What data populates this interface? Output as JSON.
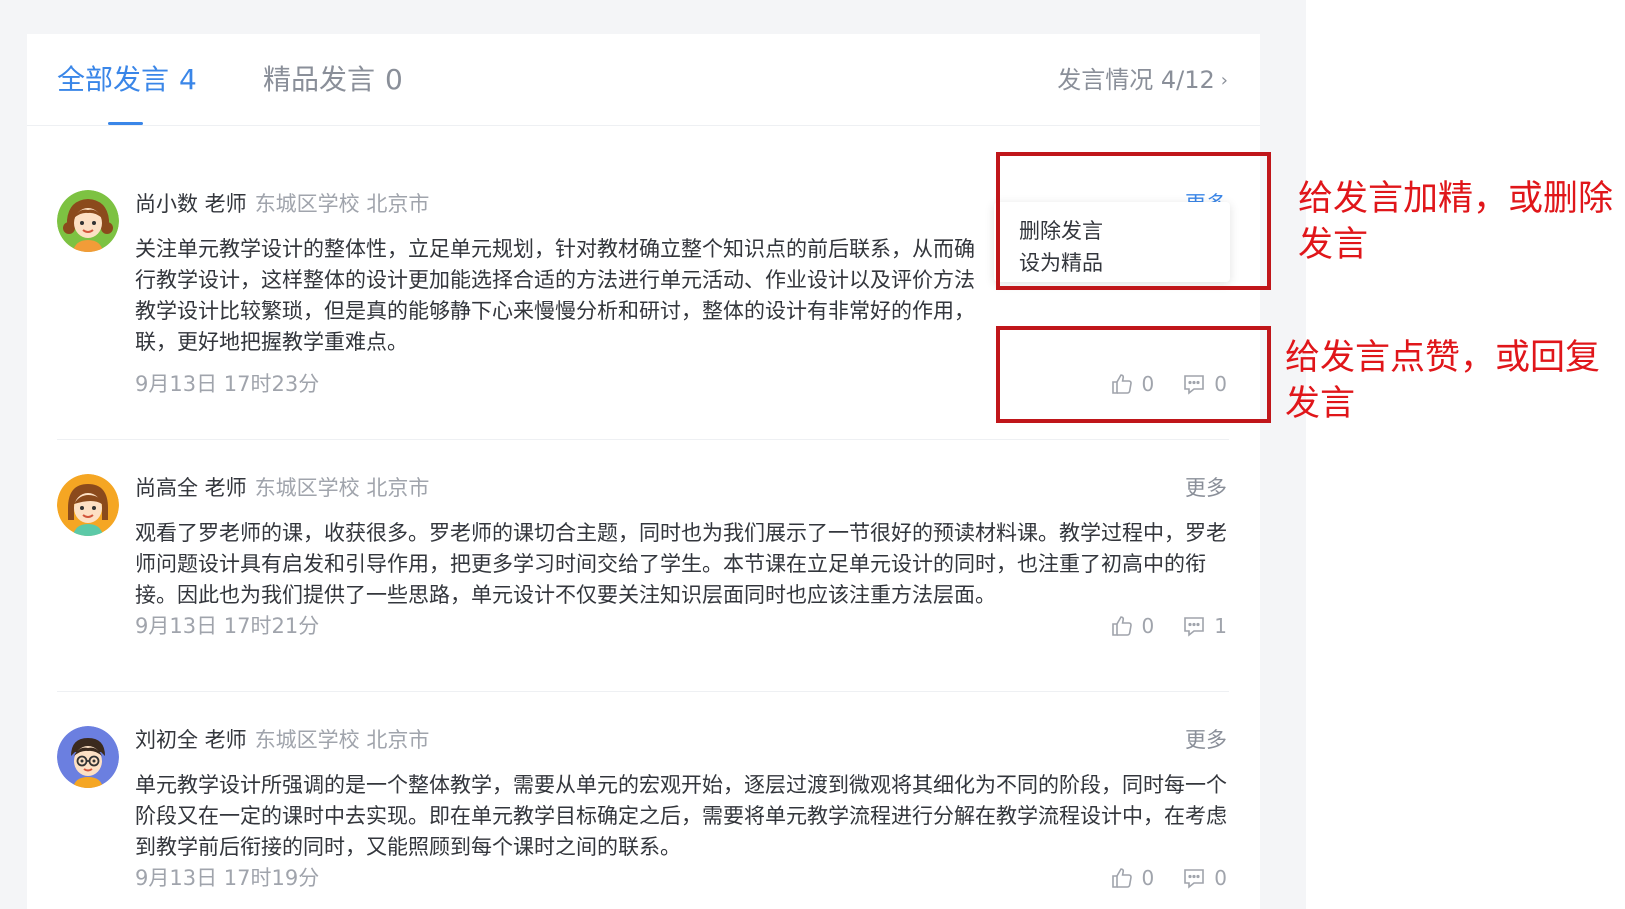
{
  "tabs": {
    "all_label": "全部发言",
    "all_count": "4",
    "best_label": "精品发言",
    "best_count": "0",
    "stats_label": "发言情况 4/12",
    "stats_chevron": "›"
  },
  "comments": [
    {
      "name": "尚小数 老师",
      "meta": "东城区学校 北京市",
      "more": "更多",
      "text": "关注单元教学设计的整体性，立足单元规划，针对教材确立整个知识点的前后联系，从而确行教学设计，这样整体的设计更加能选择合适的方法进行单元活动、作业设计以及评价方法教学设计比较繁琐，但是真的能够静下心来慢慢分析和研讨，整体的设计有非常好的作用，联，更好地把握教学重难点。",
      "time": "9月13日 17时23分",
      "likes": "0",
      "replies": "0",
      "avatar_color": "#7dc242"
    },
    {
      "name": "尚高全 老师",
      "meta": "东城区学校 北京市",
      "more": "更多",
      "text": "观看了罗老师的课，收获很多。罗老师的课切合主题，同时也为我们展示了一节很好的预读材料课。教学过程中，罗老师问题设计具有启发和引导作用，把更多学习时间交给了学生。本节课在立足单元设计的同时，也注重了初高中的衔接。因此也为我们提供了一些思路，单元设计不仅要关注知识层面同时也应该注重方法层面。",
      "time": "9月13日 17时21分",
      "likes": "0",
      "replies": "1",
      "avatar_color": "#f5a623"
    },
    {
      "name": "刘初全 老师",
      "meta": "东城区学校 北京市",
      "more": "更多",
      "text": "单元教学设计所强调的是一个整体教学，需要从单元的宏观开始，逐层过渡到微观将其细化为不同的阶段，同时每一个阶段又在一定的课时中去实现。即在单元教学目标确定之后，需要将单元教学流程进行分解在教学流程设计中，在考虑到教学前后衔接的同时，又能照顾到每个课时之间的联系。",
      "time": "9月13日 17时19分",
      "likes": "0",
      "replies": "0",
      "avatar_color": "#6b7fe0"
    }
  ],
  "dropdown": {
    "delete_label": "删除发言",
    "feature_label": "设为精品"
  },
  "annotations": {
    "note1": "给发言加精，或删除发言",
    "note2": "给发言点赞，或回复发言",
    "color": "#e0161a"
  },
  "colors": {
    "accent": "#3a86e8",
    "muted": "#a0a4ac",
    "text": "#33363c"
  }
}
